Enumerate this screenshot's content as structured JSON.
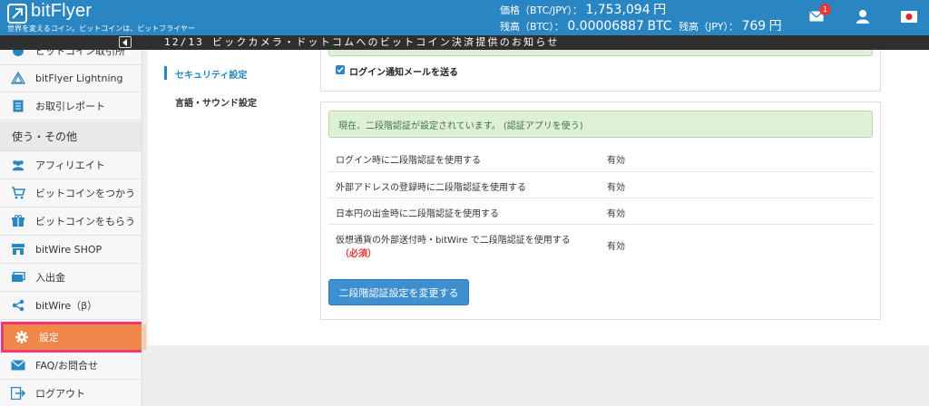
{
  "header": {
    "logo": "bitFlyer",
    "tagline": "世界を変えるコイン。ビットコインは、ビットフライヤー",
    "price_label": "価格（BTC/JPY）：",
    "price_value": "1,753,094",
    "price_unit": "円",
    "btc_balance_label": "残高（BTC）：",
    "btc_balance_value": "0.00006887",
    "btc_unit": "BTC",
    "jpy_balance_label": "残高（JPY）：",
    "jpy_balance_value": "769",
    "jpy_unit": "円",
    "mail_badge": "1",
    "icons": {
      "mail": "mail-icon",
      "user": "user-icon",
      "flag": "japan-flag-icon"
    }
  },
  "ticker": {
    "text": "12/13 ビックカメラ・ドットコムへのビットコイン決済提供のお知らせ"
  },
  "sidebar": {
    "items_top": [
      {
        "label": "ビットコイン取引所",
        "icon": "exchange-icon"
      },
      {
        "label": "bitFlyer Lightning",
        "icon": "lightning-triangle-icon"
      },
      {
        "label": "お取引レポート",
        "icon": "report-icon"
      }
    ],
    "section_label": "使う・その他",
    "items_bottom": [
      {
        "label": "アフィリエイト",
        "icon": "affiliate-icon"
      },
      {
        "label": "ビットコインをつかう",
        "icon": "cart-icon"
      },
      {
        "label": "ビットコインをもらう",
        "icon": "gift-icon"
      },
      {
        "label": "bitWire SHOP",
        "icon": "shop-icon"
      },
      {
        "label": "入出金",
        "icon": "deposit-icon"
      },
      {
        "label": "bitWire（β）",
        "icon": "share-icon"
      },
      {
        "label": "設定",
        "icon": "gear-icon"
      },
      {
        "label": "FAQ/お問合せ",
        "icon": "mail-icon"
      },
      {
        "label": "ログアウト",
        "icon": "logout-icon"
      }
    ]
  },
  "subnav": {
    "security": "セキュリティ設定",
    "language": "言語・サウンド設定"
  },
  "login_notify": {
    "label": "ログイン通知メールを送る",
    "checked": true
  },
  "two_factor": {
    "status": "現在、二段階認証が設定されています。 (認証アプリを使う)",
    "rows": [
      {
        "label": "ログイン時に二段階認証を使用する",
        "value": "有効"
      },
      {
        "label": "外部アドレスの登録時に二段階認証を使用する",
        "value": "有効"
      },
      {
        "label": "日本円の出金時に二段階認証を使用する",
        "value": "有効"
      },
      {
        "label": "仮想通貨の外部送付時・bitWire で二段階認証を使用する",
        "required": "（必須）",
        "value": "有効"
      }
    ],
    "change_button": "二段階認証設定を変更する"
  },
  "colors": {
    "brand": "#2a86c3",
    "active": "#f0874a",
    "highlight": "#f4367a",
    "success": "#dff0d8"
  }
}
